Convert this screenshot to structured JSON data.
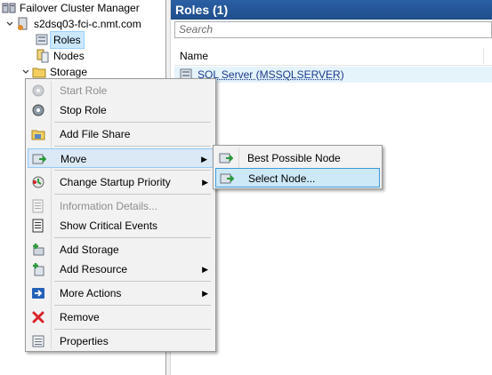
{
  "tree": {
    "root_label": "Failover Cluster Manager",
    "cluster_label": "s2dsq03-fci-c.nmt.com",
    "items": [
      {
        "label": "Roles",
        "selected": true
      },
      {
        "label": "Nodes"
      },
      {
        "label": "Storage"
      }
    ]
  },
  "roles_pane": {
    "title": "Roles (1)",
    "search_placeholder": "Search",
    "columns": [
      "Name"
    ],
    "rows": [
      {
        "name": "SQL Server (MSSQLSERVER)"
      }
    ]
  },
  "context_menu": {
    "items": [
      {
        "label": "Start Role",
        "icon": "start-role-icon",
        "disabled": true
      },
      {
        "label": "Stop Role",
        "icon": "stop-role-icon"
      },
      {
        "label": "Add File Share",
        "icon": "file-share-icon"
      },
      {
        "label": "Move",
        "icon": "move-icon",
        "submenu": true,
        "highlighted": true
      },
      {
        "label": "Change Startup Priority",
        "icon": "priority-icon",
        "submenu": true
      },
      {
        "label": "Information Details...",
        "icon": "information-icon",
        "disabled": true
      },
      {
        "label": "Show Critical Events",
        "icon": "critical-events-icon"
      },
      {
        "label": "Add Storage",
        "icon": "add-storage-icon"
      },
      {
        "label": "Add Resource",
        "icon": "add-resource-icon",
        "submenu": true
      },
      {
        "label": "More Actions",
        "icon": "more-actions-icon",
        "submenu": true
      },
      {
        "label": "Remove",
        "icon": "remove-icon"
      },
      {
        "label": "Properties",
        "icon": "properties-icon"
      }
    ]
  },
  "move_submenu": {
    "items": [
      {
        "label": "Best Possible Node",
        "icon": "best-node-icon"
      },
      {
        "label": "Select Node...",
        "icon": "select-node-icon",
        "highlighted": true
      }
    ]
  },
  "colors": {
    "header_bg": "#1f4e8c",
    "selection": "#cce8ff",
    "menu_bg": "#f2f2f2",
    "remove_red": "#d8232a"
  }
}
